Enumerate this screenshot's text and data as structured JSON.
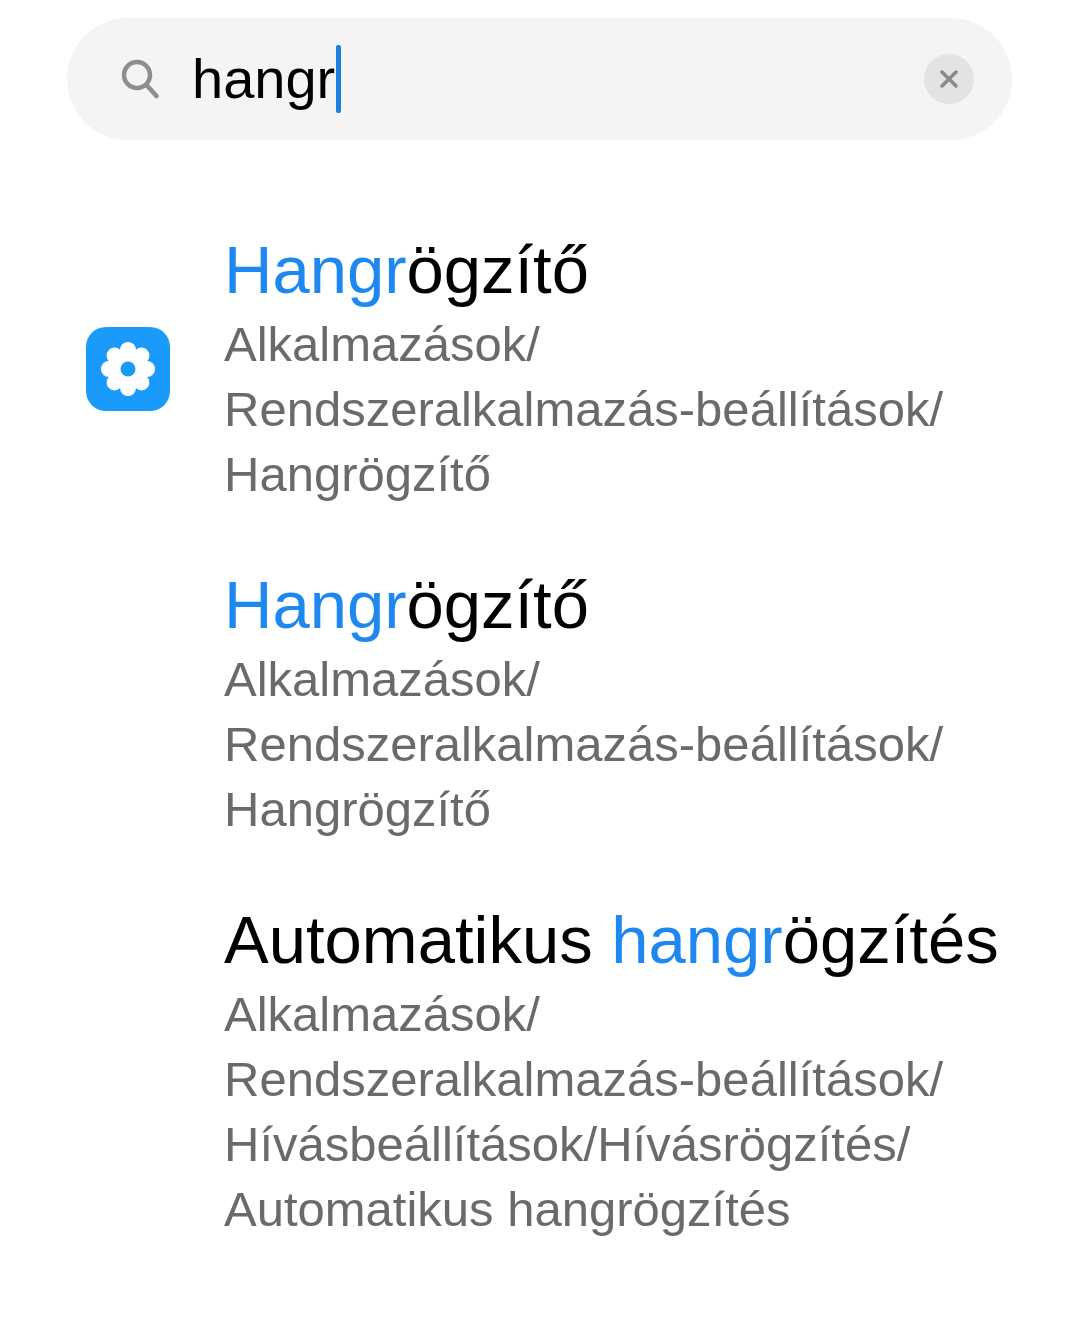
{
  "search": {
    "value": "hangr",
    "focused": true
  },
  "results": [
    {
      "has_icon": true,
      "title": [
        {
          "text": "Hangr",
          "highlight": true
        },
        {
          "text": "ögzítő",
          "highlight": false
        }
      ],
      "path": "Alkalmazások/Rendszeralkalmazás-beállítások/Hangrögzítő"
    },
    {
      "has_icon": false,
      "title": [
        {
          "text": "Hangr",
          "highlight": true
        },
        {
          "text": "ögzítő",
          "highlight": false
        }
      ],
      "path": "Alkalmazások/Rendszeralkalmazás-beállítások/Hangrögzítő"
    },
    {
      "has_icon": false,
      "title": [
        {
          "text": "Automatikus ",
          "highlight": false
        },
        {
          "text": "hangr",
          "highlight": true
        },
        {
          "text": "ögzítés",
          "highlight": false
        }
      ],
      "path": "Alkalmazások/Rendszeralkalmazás-beállítások/Hívásbeállítások/Hívásrögzítés/Automatikus hangrögzítés"
    }
  ]
}
